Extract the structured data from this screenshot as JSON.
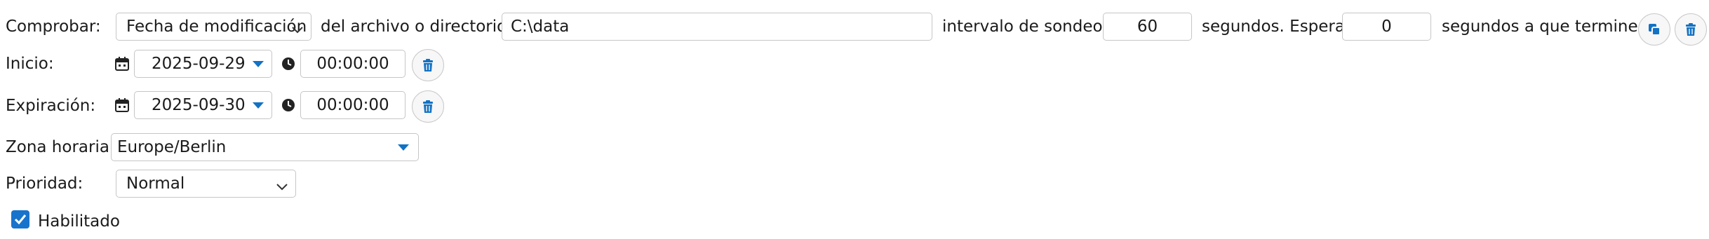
{
  "check_row": {
    "label": "Comprobar:",
    "mode_value": "Fecha de modificación",
    "of_text": "del archivo o directorio",
    "path_value": "C:\\data",
    "poll_label": "intervalo de sondeo:",
    "poll_value": "60",
    "wait_text": "segundos. Esperar",
    "wait_value": "0",
    "suffix_text": "segundos a que termine."
  },
  "start_row": {
    "label": "Inicio:",
    "date": "2025-09-29",
    "time": "00:00:00"
  },
  "expiry_row": {
    "label": "Expiración:",
    "date": "2025-09-30",
    "time": "00:00:00"
  },
  "timezone_row": {
    "label": "Zona horaria:",
    "value": "Europe/Berlin"
  },
  "priority_row": {
    "label": "Prioridad:",
    "value": "Normal"
  },
  "enabled": {
    "label": "Habilitado",
    "checked": true
  },
  "colors": {
    "accent": "#1372c4",
    "border": "#c6c6c6"
  },
  "icons": {
    "date": "calendar-icon",
    "time": "clock-icon",
    "delete": "trash-icon",
    "copy": "copy-icon"
  }
}
